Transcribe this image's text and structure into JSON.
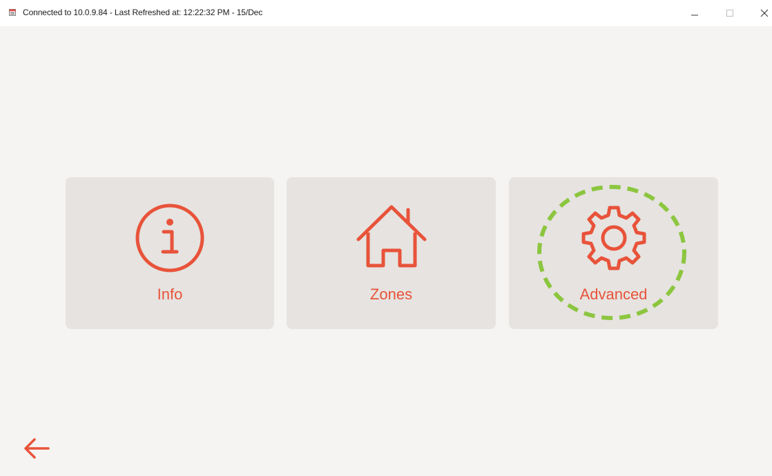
{
  "window": {
    "title": "Connected to 10.0.9.84 - Last Refreshed at: 12:22:32 PM - 15/Dec",
    "app_icon": "app-icon",
    "controls": [
      "minimize-icon",
      "maximize-icon",
      "close-icon"
    ]
  },
  "tiles": [
    {
      "label": "Info",
      "icon": "info-icon"
    },
    {
      "label": "Zones",
      "icon": "home-icon"
    },
    {
      "label": "Advanced",
      "icon": "gear-icon",
      "highlighted": true
    }
  ],
  "back": {
    "icon": "back-arrow-icon"
  },
  "colors": {
    "accent": "#e8533a",
    "tile_bg": "#e6e3e0",
    "page_bg": "#f5f4f2",
    "highlight": "#8cc63f"
  }
}
